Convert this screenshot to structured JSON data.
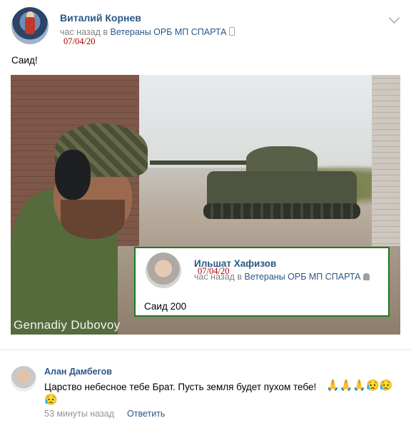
{
  "post": {
    "author": "Виталий Корнев",
    "time": "час назад в",
    "group": "Ветераны ОРБ МП СПАРТА",
    "stamp": "07/04/20",
    "text": "Саид!",
    "device_icon": "phone-icon",
    "menu_icon": "chevron-down-icon"
  },
  "photo": {
    "watermark": "Gennadiy Dubovoy"
  },
  "quoted": {
    "author": "Ильшат Хафизов",
    "time": "час назад в",
    "group": "Ветераны ОРБ МП СПАРТА",
    "stamp": "07/04/20",
    "text": "Саид 200",
    "device_icon": "android-icon",
    "border_color": "#1d7a25"
  },
  "comment": {
    "author": "Алан Дамбегов",
    "text": "Царство небесное тебе Брат. Пусть земля будет пухом тебе!",
    "emojis": "🙏🙏🙏😥😥",
    "emoji_line2": "😥",
    "time": "53 минуты назад",
    "reply_label": "Ответить"
  },
  "colors": {
    "link": "#2a5885",
    "meta": "#828282",
    "stamp": "#b00000"
  }
}
